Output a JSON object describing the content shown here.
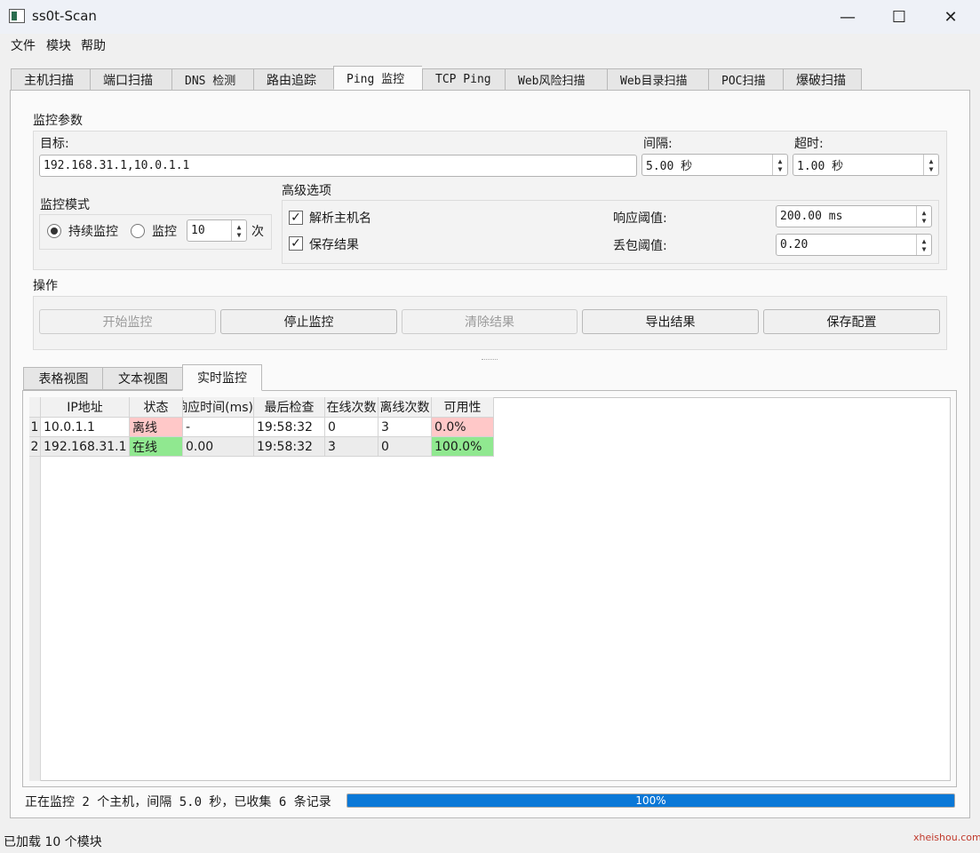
{
  "window": {
    "title": "ss0t-Scan",
    "controls": {
      "minimize": "—",
      "maximize": "☐",
      "close": "✕"
    }
  },
  "menu": [
    "文件",
    "模块",
    "帮助"
  ],
  "main_tabs": [
    "主机扫描",
    "端口扫描",
    "DNS 检测",
    "路由追踪",
    "Ping 监控",
    "TCP Ping",
    "Web风险扫描",
    "Web目录扫描",
    "POC扫描",
    "爆破扫描"
  ],
  "active_main_tab": "Ping 监控",
  "monitor_params": {
    "section_title": "监控参数",
    "target_label": "目标:",
    "target_value": "192.168.31.1,10.0.1.1",
    "interval_label": "间隔:",
    "interval_value": "5.00 秒",
    "timeout_label": "超时:",
    "timeout_value": "1.00 秒"
  },
  "monitor_mode": {
    "title": "监控模式",
    "continuous_label": "持续监控",
    "continuous_selected": true,
    "count_label": "监控",
    "count_value": "10",
    "count_unit": "次"
  },
  "advanced": {
    "title": "高级选项",
    "resolve_hostname_label": "解析主机名",
    "resolve_hostname_checked": true,
    "save_results_label": "保存结果",
    "save_results_checked": true,
    "response_threshold_label": "响应阈值:",
    "response_threshold_value": "200.00 ms",
    "loss_threshold_label": "丢包阈值:",
    "loss_threshold_value": "0.20"
  },
  "actions": {
    "title": "操作",
    "start": "开始监控",
    "stop": "停止监控",
    "clear": "清除结果",
    "export": "导出结果",
    "save_config": "保存配置"
  },
  "result_tabs": [
    "表格视图",
    "文本视图",
    "实时监控"
  ],
  "active_result_tab": "实时监控",
  "table": {
    "columns": [
      "IP地址",
      "状态",
      "响应时间(ms)",
      "最后检查",
      "在线次数",
      "离线次数",
      "可用性"
    ],
    "rows": [
      {
        "num": "1",
        "ip": "10.0.1.1",
        "status": "离线",
        "response": "-",
        "last_check": "19:58:32",
        "online": "0",
        "offline": "3",
        "availability": "0.0%"
      },
      {
        "num": "2",
        "ip": "192.168.31.1",
        "status": "在线",
        "response": "0.00",
        "last_check": "19:58:32",
        "online": "3",
        "offline": "0",
        "availability": "100.0%"
      }
    ]
  },
  "colors": {
    "offline": "#ffc8c8",
    "online": "#90e890",
    "progress": "#0a78d7"
  },
  "status_line": "正在监控 2 个主机，间隔 5.0 秒，已收集 6 条记录",
  "progress": {
    "percent": 100,
    "label": "100%"
  },
  "statusbar": "已加载 10 个模块",
  "watermark": "xheishou.com"
}
